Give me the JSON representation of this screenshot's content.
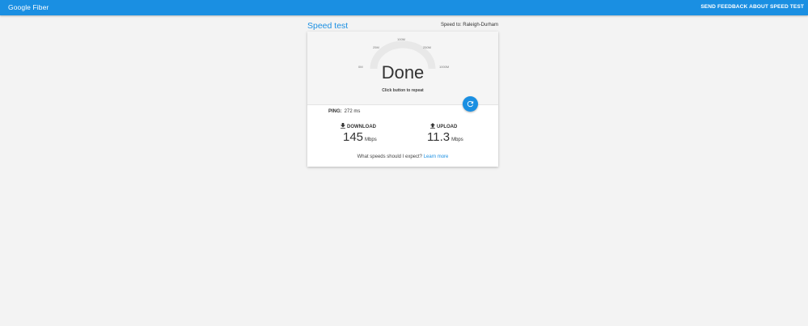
{
  "header": {
    "brand": "Google Fiber",
    "feedback_link": "SEND FEEDBACK ABOUT SPEED TEST",
    "bar_color": "#1a8fe2"
  },
  "page": {
    "title": "Speed test",
    "speed_to": "Speed to: Raleigh-Durham"
  },
  "gauge": {
    "labels": {
      "l0": "0M",
      "l25": "25M",
      "l100": "100M",
      "l250": "250M",
      "l1000": "1000M"
    },
    "status": "Done",
    "hint": "Click button to repeat",
    "repeat_icon": "refresh-icon"
  },
  "results": {
    "ping_label": "PING:",
    "ping_value": "272 ms",
    "download": {
      "label": "DOWNLOAD",
      "value": "145",
      "unit": "Mbps",
      "icon": "download-icon"
    },
    "upload": {
      "label": "UPLOAD",
      "value": "11.3",
      "unit": "Mbps",
      "icon": "upload-icon"
    }
  },
  "footer": {
    "question": "What speeds should I expect?",
    "learn_more": "Learn more"
  }
}
